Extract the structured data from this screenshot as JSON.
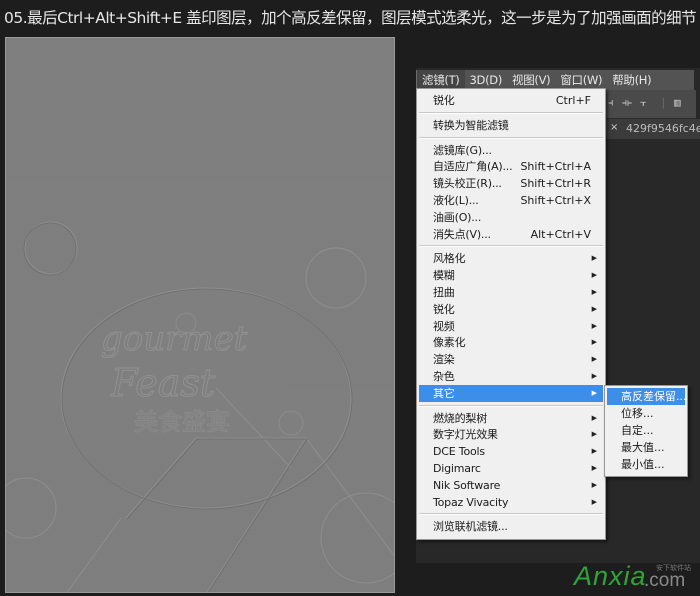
{
  "caption": "05.最后Ctrl+Alt+Shift+E 盖印图层，加个高反差保留，图层模式选柔光，这一步是为了加强画面的细节",
  "menubar": {
    "items": [
      {
        "label": "滤镜(T)",
        "active": true
      },
      {
        "label": "3D(D)"
      },
      {
        "label": "视图(V)"
      },
      {
        "label": "窗口(W)"
      },
      {
        "label": "帮助(H)"
      }
    ]
  },
  "document_tab": {
    "close_glyph": "×",
    "name": "429f9546fc4e"
  },
  "options_bar": {
    "icons": [
      "align-icon",
      "distribute-center-icon",
      "distribute-right-icon",
      "auto-align-icon"
    ]
  },
  "filter_menu": {
    "items": [
      {
        "label": "锐化",
        "shortcut": "Ctrl+F"
      },
      {
        "separator": true
      },
      {
        "label": "转换为智能滤镜"
      },
      {
        "separator": true
      },
      {
        "label": "滤镜库(G)..."
      },
      {
        "label": "自适应广角(A)...",
        "shortcut": "Shift+Ctrl+A"
      },
      {
        "label": "镜头校正(R)...",
        "shortcut": "Shift+Ctrl+R"
      },
      {
        "label": "液化(L)...",
        "shortcut": "Shift+Ctrl+X"
      },
      {
        "label": "油画(O)..."
      },
      {
        "label": "消失点(V)...",
        "shortcut": "Alt+Ctrl+V"
      },
      {
        "separator": true
      },
      {
        "label": "风格化",
        "submenu": true
      },
      {
        "label": "模糊",
        "submenu": true
      },
      {
        "label": "扭曲",
        "submenu": true
      },
      {
        "label": "锐化",
        "submenu": true
      },
      {
        "label": "视频",
        "submenu": true
      },
      {
        "label": "像素化",
        "submenu": true
      },
      {
        "label": "渲染",
        "submenu": true
      },
      {
        "label": "杂色",
        "submenu": true
      },
      {
        "label": "其它",
        "submenu": true,
        "highlighted": true
      },
      {
        "separator": true
      },
      {
        "label": " 燃烧的梨树",
        "submenu": true
      },
      {
        "label": " 数字灯光效果",
        "submenu": true
      },
      {
        "label": "DCE Tools",
        "submenu": true
      },
      {
        "label": "Digimarc",
        "submenu": true
      },
      {
        "label": "Nik Software",
        "submenu": true
      },
      {
        "label": "Topaz Vivacity",
        "submenu": true
      },
      {
        "separator": true
      },
      {
        "label": "浏览联机滤镜..."
      }
    ]
  },
  "other_submenu": {
    "items": [
      {
        "label": "高反差保留...",
        "highlighted": true
      },
      {
        "label": "位移..."
      },
      {
        "label": "自定..."
      },
      {
        "label": "最大值..."
      },
      {
        "label": "最小值..."
      }
    ]
  },
  "canvas": {
    "description": "high-pass filtered poster artwork",
    "artwork_text": [
      "gourmet",
      "Feast",
      "美食盛宴"
    ]
  },
  "watermark": {
    "brand": "Anxia",
    "suffix": ".com",
    "tagline": "安下软件站",
    "brand_color": "#2ea43a"
  },
  "colors": {
    "menu_highlight": "#3c8ee8",
    "menu_bg": "#f0f0f0",
    "menubar_bg": "#535353",
    "canvas_gray": "#7f7f7f"
  }
}
